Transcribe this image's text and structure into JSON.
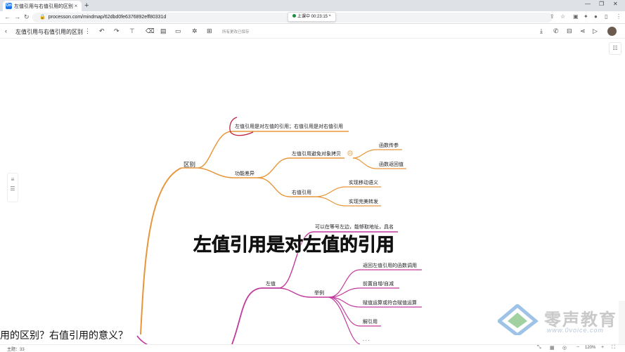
{
  "browser": {
    "tab_title": "左值引用与右值引用的区别? 右...",
    "tab_close": "×",
    "new_tab": "+",
    "url": "processon.com/mindmap/62dbd0fe6376892eff80331d",
    "recording": "上课中 00:23:15",
    "recording_caret": "^"
  },
  "toolbar": {
    "doc_title": "左值引用与右值引用的区别",
    "save_status": "所有更改已保存"
  },
  "mindmap": {
    "l1_difference": "区别",
    "n_lref_to_lvalue": "左值引用是对左值的引用；右值引用是对右值引用",
    "n_func_diff": "功能差异",
    "n_lref_avoid_copy": "左值引用避免对象拷贝",
    "n_arg_pass": "函数传参",
    "n_ret_val": "函数返回值",
    "n_rref": "右值引用",
    "n_move_sem": "实现移动语义",
    "n_perfect_fwd": "实现完美转发",
    "n_lvalue_desc": "可以在等号左边，能够取地址，具名",
    "l2_lvalue": "左值",
    "n_example": "举例",
    "ex_1": "返回左值引用的函数调用",
    "ex_2": "前置自增/自减",
    "ex_3": "赋值运算或符合赋值运算",
    "ex_4": "解引用",
    "ex_more": ". . ."
  },
  "captions": {
    "main": "左值引用是对左值的引用",
    "sub": "用的区别？右值引用的意义？"
  },
  "watermark": {
    "name": "零声教育",
    "url": "www.0voice.com"
  },
  "status": {
    "topic_count": "主题：33",
    "zoom": "120%"
  },
  "colors": {
    "orange_branch": "#e8963a",
    "purple_branch": "#c2399c",
    "red_annotation": "#c0203a"
  }
}
